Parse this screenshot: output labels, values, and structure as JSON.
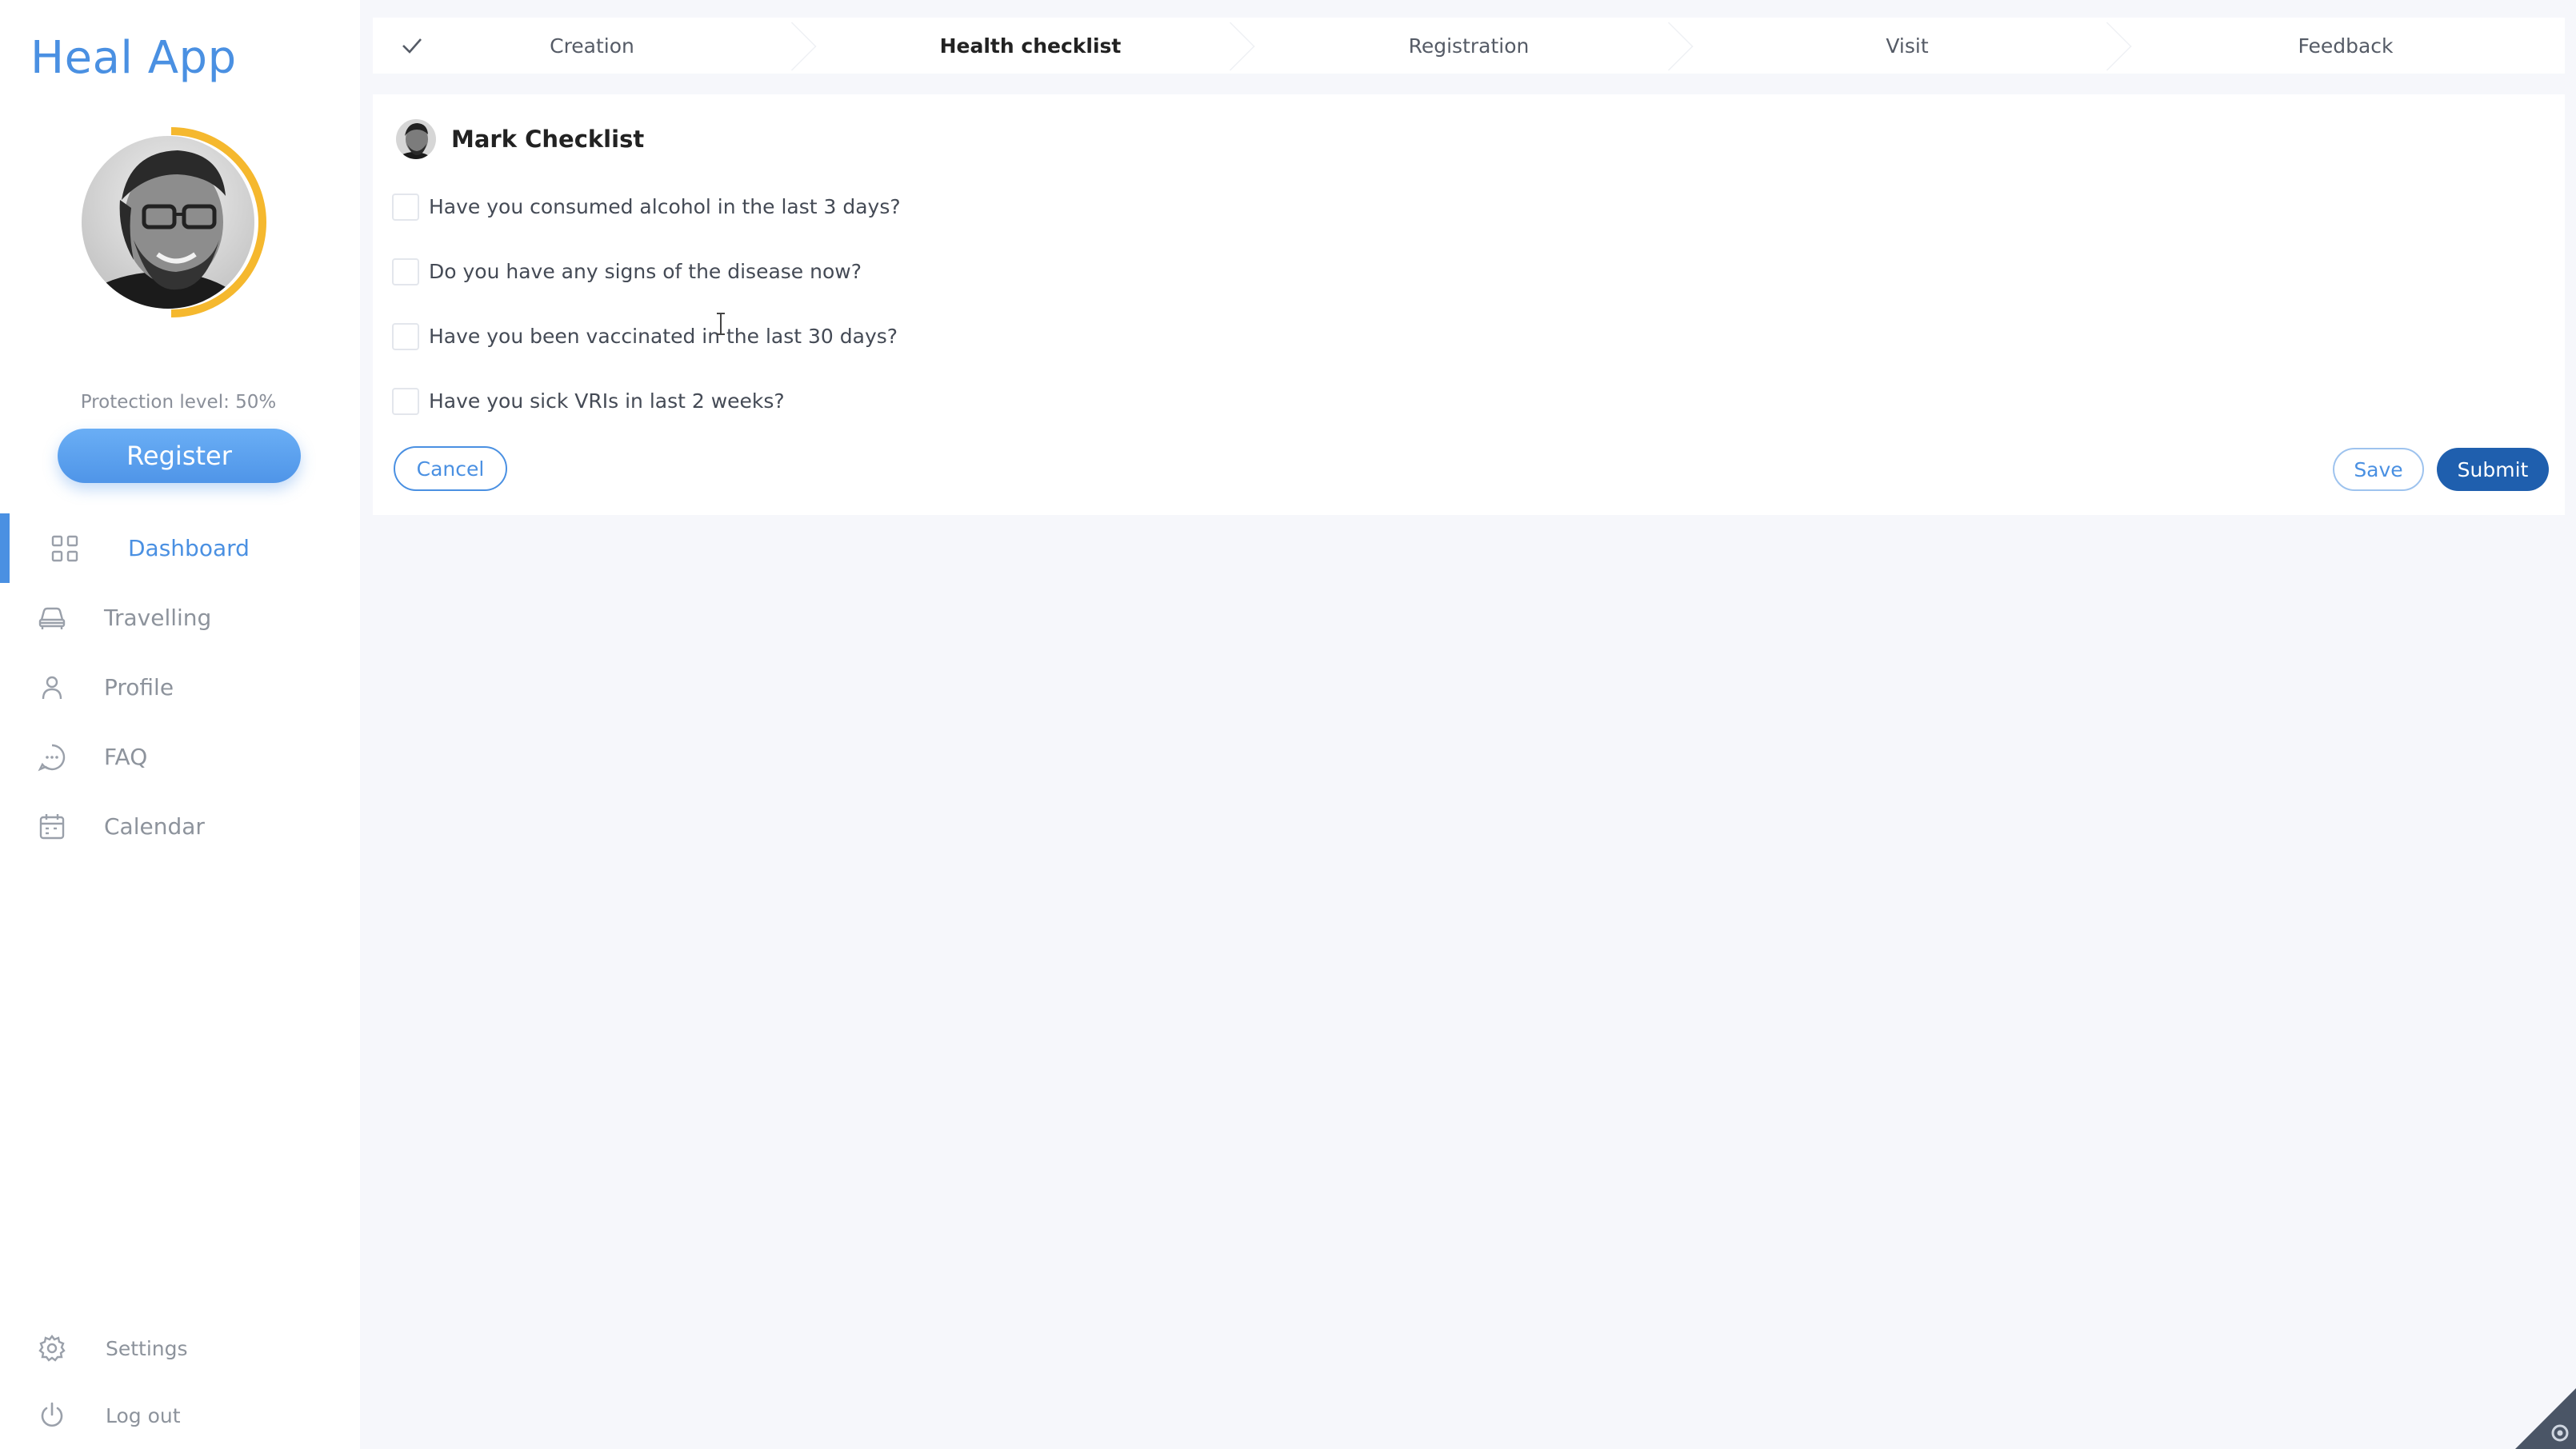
{
  "app": {
    "title": "Heal App"
  },
  "sidebar": {
    "protection_text": "Protection level: 50%",
    "protection_level": 0.5,
    "register_label": "Register",
    "nav_items": [
      {
        "label": "Dashboard",
        "icon": "grid-icon",
        "active": true
      },
      {
        "label": "Travelling",
        "icon": "car-icon",
        "active": false
      },
      {
        "label": "Profile",
        "icon": "user-icon",
        "active": false
      },
      {
        "label": "FAQ",
        "icon": "chat-icon",
        "active": false
      },
      {
        "label": "Calendar",
        "icon": "calendar-icon",
        "active": false
      }
    ],
    "bottom_items": [
      {
        "label": "Settings",
        "icon": "gear-icon"
      },
      {
        "label": "Log out",
        "icon": "power-icon"
      }
    ]
  },
  "stepper": {
    "steps": [
      {
        "label": "Creation",
        "state": "done"
      },
      {
        "label": "Health checklist",
        "state": "current"
      },
      {
        "label": "Registration",
        "state": "pending"
      },
      {
        "label": "Visit",
        "state": "pending"
      },
      {
        "label": "Feedback",
        "state": "pending"
      }
    ]
  },
  "checklist": {
    "title": "Mark Checklist",
    "questions": [
      {
        "text": "Have you consumed alcohol in the last 3 days?",
        "checked": false
      },
      {
        "text": "Do you have any signs of the disease now?",
        "checked": false
      },
      {
        "text": "Have you been vaccinated in the last 30 days?",
        "checked": false
      },
      {
        "text": "Have you sick VRIs in last 2 weeks?",
        "checked": false
      }
    ],
    "cancel_label": "Cancel",
    "save_label": "Save",
    "submit_label": "Submit"
  },
  "colors": {
    "accent": "#4a90e2",
    "submit": "#1f5fae",
    "progress_ring": "#f5b82e"
  }
}
